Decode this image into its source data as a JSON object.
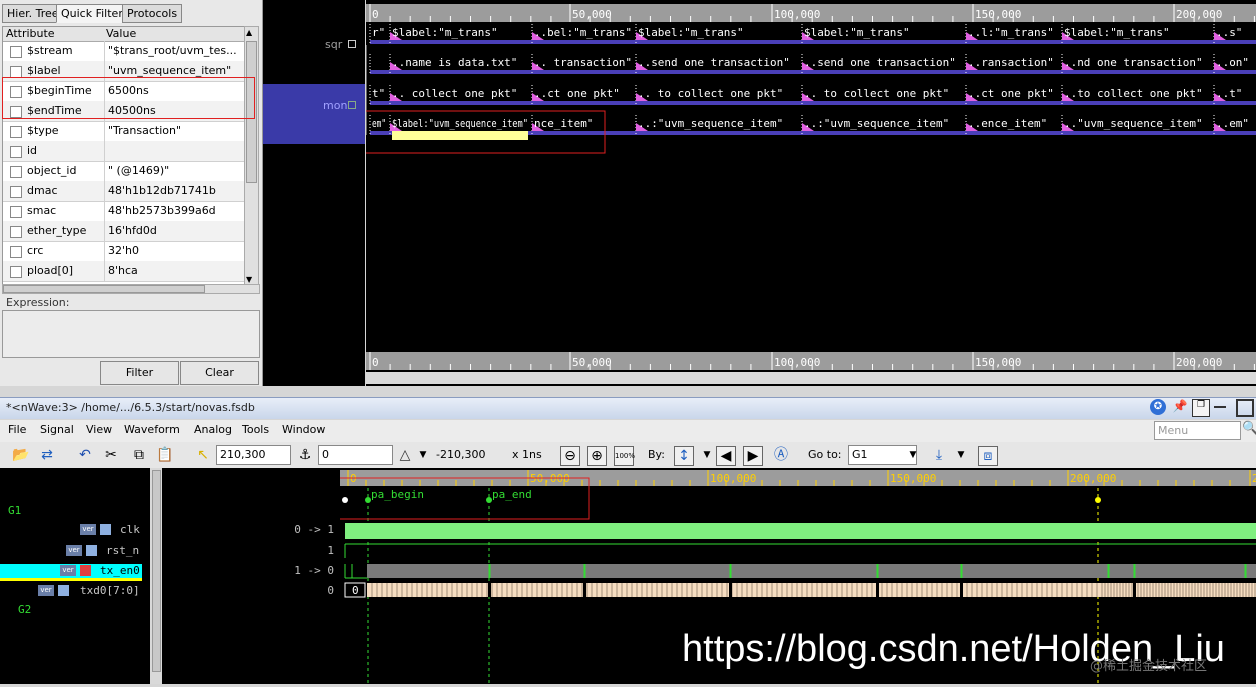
{
  "tabs": [
    {
      "label": "Hier. Tree"
    },
    {
      "label": "Quick Filter"
    },
    {
      "label": "Protocols"
    }
  ],
  "attr_table": {
    "headers": [
      "Attribute",
      "Value"
    ],
    "rows": [
      {
        "name": "$stream",
        "value": "\"$trans_root/uvm_tes..."
      },
      {
        "name": "$label",
        "value": "\"uvm_sequence_item\""
      },
      {
        "name": "$beginTime",
        "value": "6500ns"
      },
      {
        "name": "$endTime",
        "value": "40500ns"
      },
      {
        "name": "$type",
        "value": "\"Transaction\""
      },
      {
        "name": "id",
        "value": ""
      },
      {
        "name": "object_id",
        "value": "\" (@1469)\""
      },
      {
        "name": "dmac",
        "value": "48'h1b12db71741b"
      },
      {
        "name": "smac",
        "value": "48'hb2573b399a6d"
      },
      {
        "name": "ether_type",
        "value": "16'hfd0d"
      },
      {
        "name": "crc",
        "value": "32'h0"
      },
      {
        "name": "pload[0]",
        "value": "8'hca"
      }
    ]
  },
  "expression_label": "Expression:",
  "filter_button": "Filter",
  "clear_button": "Clear",
  "stream_pane": {
    "signals": [
      "sqr",
      "mon"
    ],
    "ruler_ticks": [
      "0",
      "50,000",
      "100,000",
      "150,000",
      "200,000"
    ],
    "rows": [
      [
        "r\"",
        "$label:\"m_trans\"",
        "..bel:\"m_trans\"",
        "$label:\"m_trans\"",
        "$label:\"m_trans\"",
        "..l:\"m_trans\"",
        "$label:\"m_trans\"",
        "..s\""
      ],
      [
        "",
        "..name is data.txt\"",
        ".. transaction\"",
        "..send one transaction\"",
        "..send one transaction\"",
        "..ransaction\"",
        "..nd one transaction\"",
        "..on\""
      ],
      [
        "t\"",
        ".. collect one pkt\"",
        "..ct one pkt\"",
        ".. to collect one pkt\"",
        ".. to collect one pkt\"",
        "..ct one pkt\"",
        "..to collect one pkt\"",
        "..t\""
      ],
      [
        "em\"",
        "$label:\"uvm_sequence_item\"",
        "nce_item\"",
        "..:\"uvm_sequence_item\"",
        "..:\"uvm_sequence_item\"",
        "..ence_item\"",
        "..\"uvm_sequence_item\"",
        "..em\""
      ]
    ]
  },
  "nwave": {
    "title": "*<nWave:3> /home/.../6.5.3/start/novas.fsdb",
    "menus": [
      "File",
      "Signal",
      "View",
      "Waveform",
      "Analog",
      "Tools",
      "Window"
    ],
    "menu_search_placeholder": "Menu",
    "toolbar": {
      "cursor_time": "210,300",
      "marker_time": "0",
      "delta": "-210,300",
      "time_unit": "x 1ns",
      "by_label": "By:",
      "goto_label": "Go to:",
      "goto_value": "G1"
    },
    "ruler_ticks": [
      "0",
      "50,000",
      "100,000",
      "150,000",
      "200,000",
      "25"
    ],
    "markers": [
      {
        "label": "pa_begin"
      },
      {
        "label": "pa_end"
      }
    ],
    "groups": [
      "G1",
      "G2"
    ],
    "signals": [
      {
        "name": "clk",
        "value": "0 -> 1"
      },
      {
        "name": "rst_n",
        "value": "1"
      },
      {
        "name": "tx_en0",
        "value": "1 -> 0"
      },
      {
        "name": "txd0[7:0]",
        "value": "0"
      }
    ],
    "bus_first_value": "0",
    "ver_badge": "ver"
  },
  "watermark": "https://blog.csdn.net/Holden_Liu",
  "watermark2": "@稀土掘金技术社区",
  "colors": {
    "accent": "#6a5acd",
    "selection": "#00ffff",
    "highlight": "#ff0000",
    "clk": "#80ef80"
  }
}
